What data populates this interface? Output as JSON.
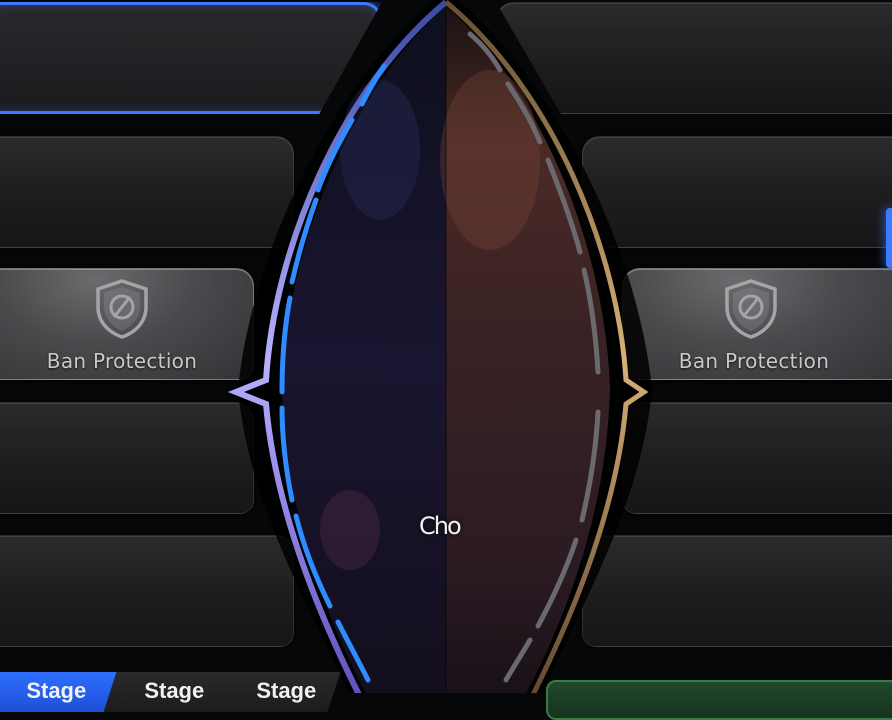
{
  "left_team": {
    "slots": [
      {
        "state": "active",
        "label": ""
      },
      {
        "state": "empty",
        "label": ""
      },
      {
        "state": "ban_protection",
        "label": "Ban Protection"
      },
      {
        "state": "empty",
        "label": ""
      },
      {
        "state": "empty",
        "label": ""
      }
    ]
  },
  "right_team": {
    "slots": [
      {
        "state": "empty",
        "label": ""
      },
      {
        "state": "empty",
        "label": ""
      },
      {
        "state": "ban_protection",
        "label": "Ban Protection"
      },
      {
        "state": "empty",
        "label": ""
      },
      {
        "state": "empty",
        "label": ""
      }
    ]
  },
  "center": {
    "text": "Cho"
  },
  "stage_tabs": [
    {
      "label": "Stage",
      "active": true
    },
    {
      "label": "Stage",
      "active": false
    },
    {
      "label": "Stage",
      "active": false
    }
  ],
  "colors": {
    "accent_blue": "#3f78ff",
    "accent_gold": "#b89060",
    "ban_gray": "#4a4a4d",
    "green_button": "#3a7a45"
  },
  "icons": {
    "ban_protection": "shield-ban-icon"
  }
}
